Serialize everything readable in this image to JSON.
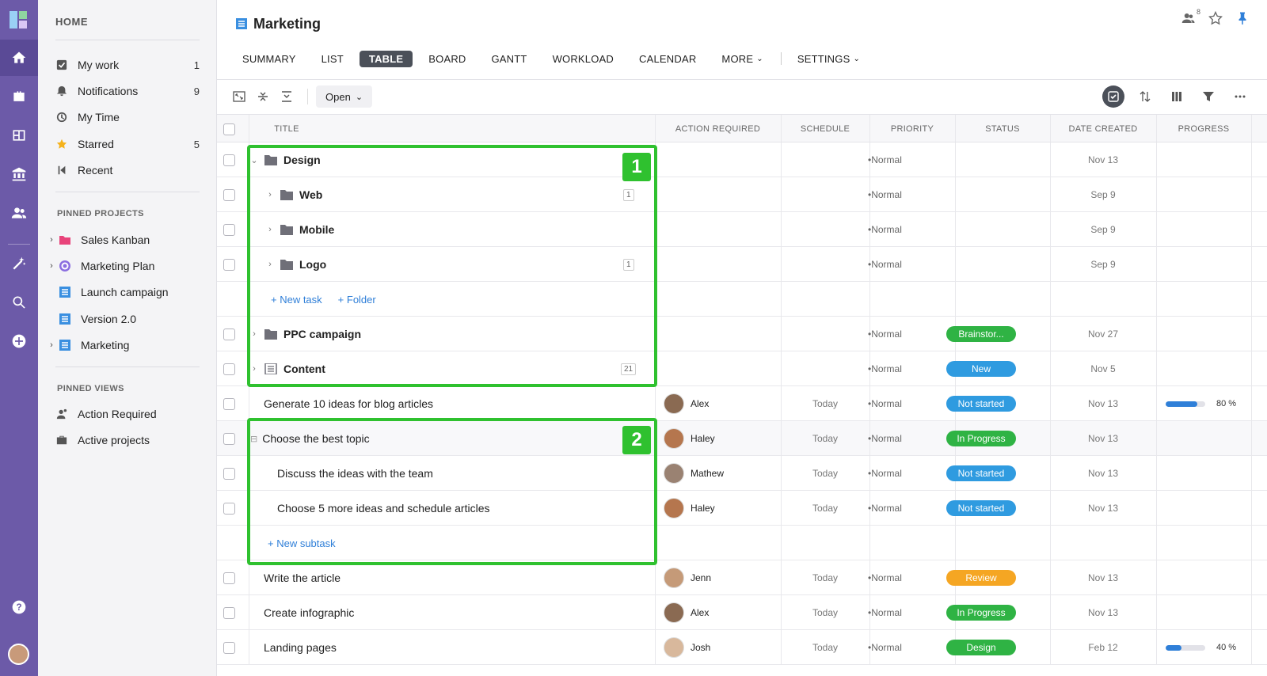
{
  "rail": {
    "items": [
      "home-icon",
      "briefcase-icon",
      "board-icon",
      "bank-icon",
      "people-icon",
      "magic-wand-icon",
      "search-icon",
      "add-icon"
    ],
    "help": "help-icon"
  },
  "sidebar": {
    "home": "HOME",
    "items": [
      {
        "label": "My work",
        "count": "1"
      },
      {
        "label": "Notifications",
        "count": "9"
      },
      {
        "label": "My Time",
        "count": ""
      },
      {
        "label": "Starred",
        "count": "5"
      },
      {
        "label": "Recent",
        "count": ""
      }
    ],
    "pinned_projects_label": "PINNED PROJECTS",
    "projects": [
      {
        "label": "Sales Kanban",
        "color": "#e8437a"
      },
      {
        "label": "Marketing Plan",
        "color": "#8b6ee0"
      },
      {
        "label": "Launch campaign",
        "color": "#3a8fe0"
      },
      {
        "label": "Version 2.0",
        "color": "#3a8fe0"
      },
      {
        "label": "Marketing",
        "color": "#3a8fe0"
      }
    ],
    "pinned_views_label": "PINNED VIEWS",
    "views": [
      {
        "label": "Action Required"
      },
      {
        "label": "Active projects"
      }
    ]
  },
  "header": {
    "title": "Marketing",
    "members_count": "8",
    "tabs": [
      "SUMMARY",
      "LIST",
      "TABLE",
      "BOARD",
      "GANTT",
      "WORKLOAD",
      "CALENDAR",
      "MORE"
    ],
    "settings": "SETTINGS"
  },
  "toolbar": {
    "filter_value": "Open"
  },
  "table": {
    "columns": [
      "TITLE",
      "ACTION REQUIRED",
      "SCHEDULE",
      "PRIORITY",
      "STATUS",
      "DATE CREATED",
      "PROGRESS"
    ],
    "rows": [
      {
        "title": "Design",
        "kind": "folder",
        "level": 0,
        "expanded": true,
        "bold": true,
        "priority": "Normal",
        "date": "Nov 13"
      },
      {
        "title": "Web",
        "kind": "folder",
        "level": 1,
        "bold": true,
        "count": "1",
        "priority": "Normal",
        "date": "Sep 9"
      },
      {
        "title": "Mobile",
        "kind": "folder",
        "level": 1,
        "bold": true,
        "priority": "Normal",
        "date": "Sep 9"
      },
      {
        "title": "Logo",
        "kind": "folder",
        "level": 1,
        "bold": true,
        "count": "1",
        "priority": "Normal",
        "date": "Sep 9"
      },
      {
        "kind": "add",
        "new_task": "+ New task",
        "new_folder": "+ Folder"
      },
      {
        "title": "PPC campaign",
        "kind": "folder",
        "level": 0,
        "bold": true,
        "priority": "Normal",
        "status": "Brainstor...",
        "status_color": "#2fb344",
        "date": "Nov 27"
      },
      {
        "title": "Content",
        "kind": "list",
        "level": 0,
        "bold": true,
        "count": "21",
        "priority": "Normal",
        "status": "New",
        "status_color": "#2f9be0",
        "date": "Nov 5"
      },
      {
        "title": "Generate 10 ideas for blog articles",
        "kind": "task",
        "person": "Alex",
        "schedule": "Today",
        "priority": "Normal",
        "status": "Not started",
        "status_color": "#2f9be0",
        "date": "Nov 13",
        "progress": 0.8,
        "progress_label": "80 %"
      },
      {
        "title": "Choose the best topic",
        "kind": "task",
        "collapsible": true,
        "highlight": true,
        "person": "Haley",
        "schedule": "Today",
        "priority": "Normal",
        "status": "In Progress",
        "status_color": "#2fb344",
        "date": "Nov 13"
      },
      {
        "title": "Discuss the ideas with the team",
        "kind": "subtask",
        "person": "Mathew",
        "schedule": "Today",
        "priority": "Normal",
        "status": "Not started",
        "status_color": "#2f9be0",
        "date": "Nov 13"
      },
      {
        "title": "Choose 5 more ideas and schedule articles",
        "kind": "subtask",
        "person": "Haley",
        "schedule": "Today",
        "priority": "Normal",
        "status": "Not started",
        "status_color": "#2f9be0",
        "date": "Nov 13"
      },
      {
        "kind": "add-subtask",
        "new_subtask": "+ New subtask"
      },
      {
        "title": "Write the article",
        "kind": "task",
        "person": "Jenn",
        "schedule": "Today",
        "priority": "Normal",
        "status": "Review",
        "status_color": "#f5a623",
        "date": "Nov 13"
      },
      {
        "title": "Create infographic",
        "kind": "task",
        "person": "Alex",
        "schedule": "Today",
        "priority": "Normal",
        "status": "In Progress",
        "status_color": "#2fb344",
        "date": "Nov 13"
      },
      {
        "title": "Landing pages",
        "kind": "task",
        "person": "Josh",
        "schedule": "Today",
        "priority": "Normal",
        "status": "Design",
        "status_color": "#2fb344",
        "date": "Feb 12",
        "progress": 0.4,
        "progress_label": "40 %"
      }
    ]
  },
  "callouts": [
    "1",
    "2"
  ],
  "colors": {
    "rail": "#6c5aa8",
    "accent_green": "#2fc12f",
    "link": "#2f7fd8"
  }
}
